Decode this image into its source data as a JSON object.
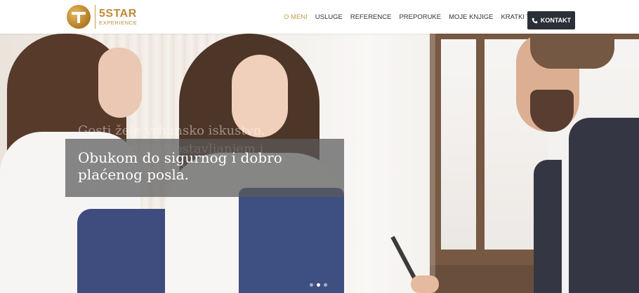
{
  "brand": {
    "title": "5STAR",
    "subtitle": "EXPERIENCE",
    "colors": {
      "gold": "#c08a35",
      "nav_active": "#c89a4a",
      "button_bg": "#2b2f38"
    }
  },
  "nav": {
    "items": [
      {
        "label": "O MENI",
        "active": true
      },
      {
        "label": "USLUGE",
        "active": false
      },
      {
        "label": "REFERENCE",
        "active": false
      },
      {
        "label": "PREPORUKE",
        "active": false
      },
      {
        "label": "MOJE KNJIGE",
        "active": false
      },
      {
        "label": "KRATKI TEKSTOVI",
        "active": false
      }
    ],
    "contact_label": "KONTAKT",
    "contact_icon": "phone-icon"
  },
  "hero": {
    "ghost_text": "Gosti žele vrhunsko iskustvo. Postižemo ga postavljanjem i održavanjem vrhunskih zaposlenih.",
    "caption": "Obukom do sigurnog i dobro plaćenog posla.",
    "slides": 3,
    "active_slide": 1
  }
}
